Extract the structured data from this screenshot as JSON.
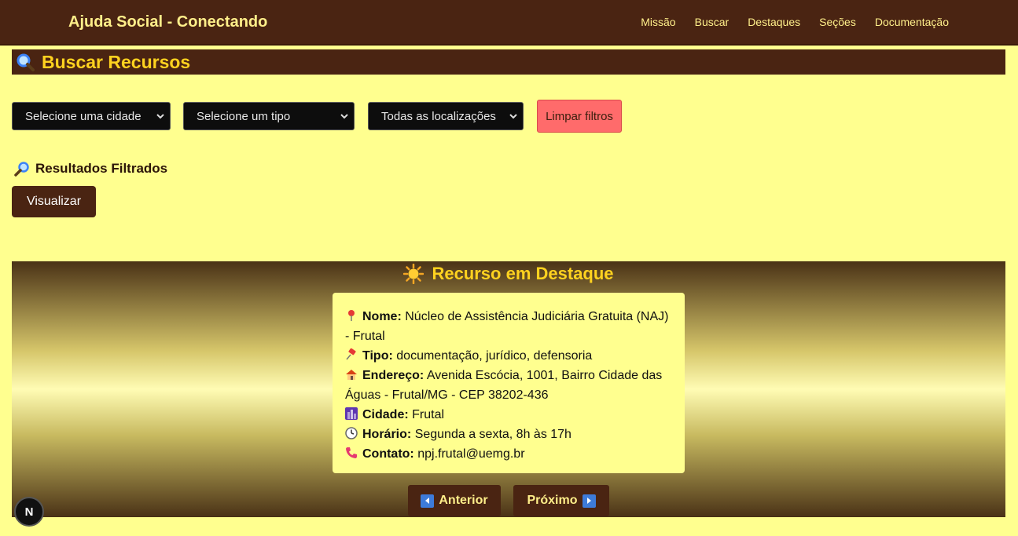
{
  "navbar": {
    "brand": "Ajuda Social - Conectando",
    "links": [
      "Missão",
      "Buscar",
      "Destaques",
      "Seções",
      "Documentação"
    ]
  },
  "search": {
    "title": "Buscar Recursos",
    "city_select": "Selecione uma cidade",
    "type_select": "Selecione um tipo",
    "location_select": "Todas as localizações",
    "clear_button": "Limpar filtros"
  },
  "results": {
    "heading": "Resultados Filtrados",
    "view_button": "Visualizar"
  },
  "featured": {
    "title": "Recurso em Destaque",
    "card": {
      "name_label": "Nome:",
      "name_value": "Núcleo de Assistência Judiciária Gratuita (NAJ) - Frutal",
      "type_label": "Tipo:",
      "type_value": "documentação, jurídico, defensoria",
      "address_label": "Endereço:",
      "address_value": "Avenida Escócia, 1001, Bairro Cidade das Águas - Frutal/MG - CEP 38202-436",
      "city_label": "Cidade:",
      "city_value": "Frutal",
      "hours_label": "Horário:",
      "hours_value": "Segunda a sexta, 8h às 17h",
      "contact_label": "Contato:",
      "contact_value": "npj.frutal@uemg.br"
    },
    "prev_button": "Anterior",
    "next_button": "Próximo"
  },
  "badge": {
    "letter": "N"
  },
  "colors": {
    "navbar_bg": "#4a2412",
    "page_bg": "#ffff8f",
    "accent_text": "#ffd21f",
    "clear_button_bg": "#ff6b6b"
  }
}
